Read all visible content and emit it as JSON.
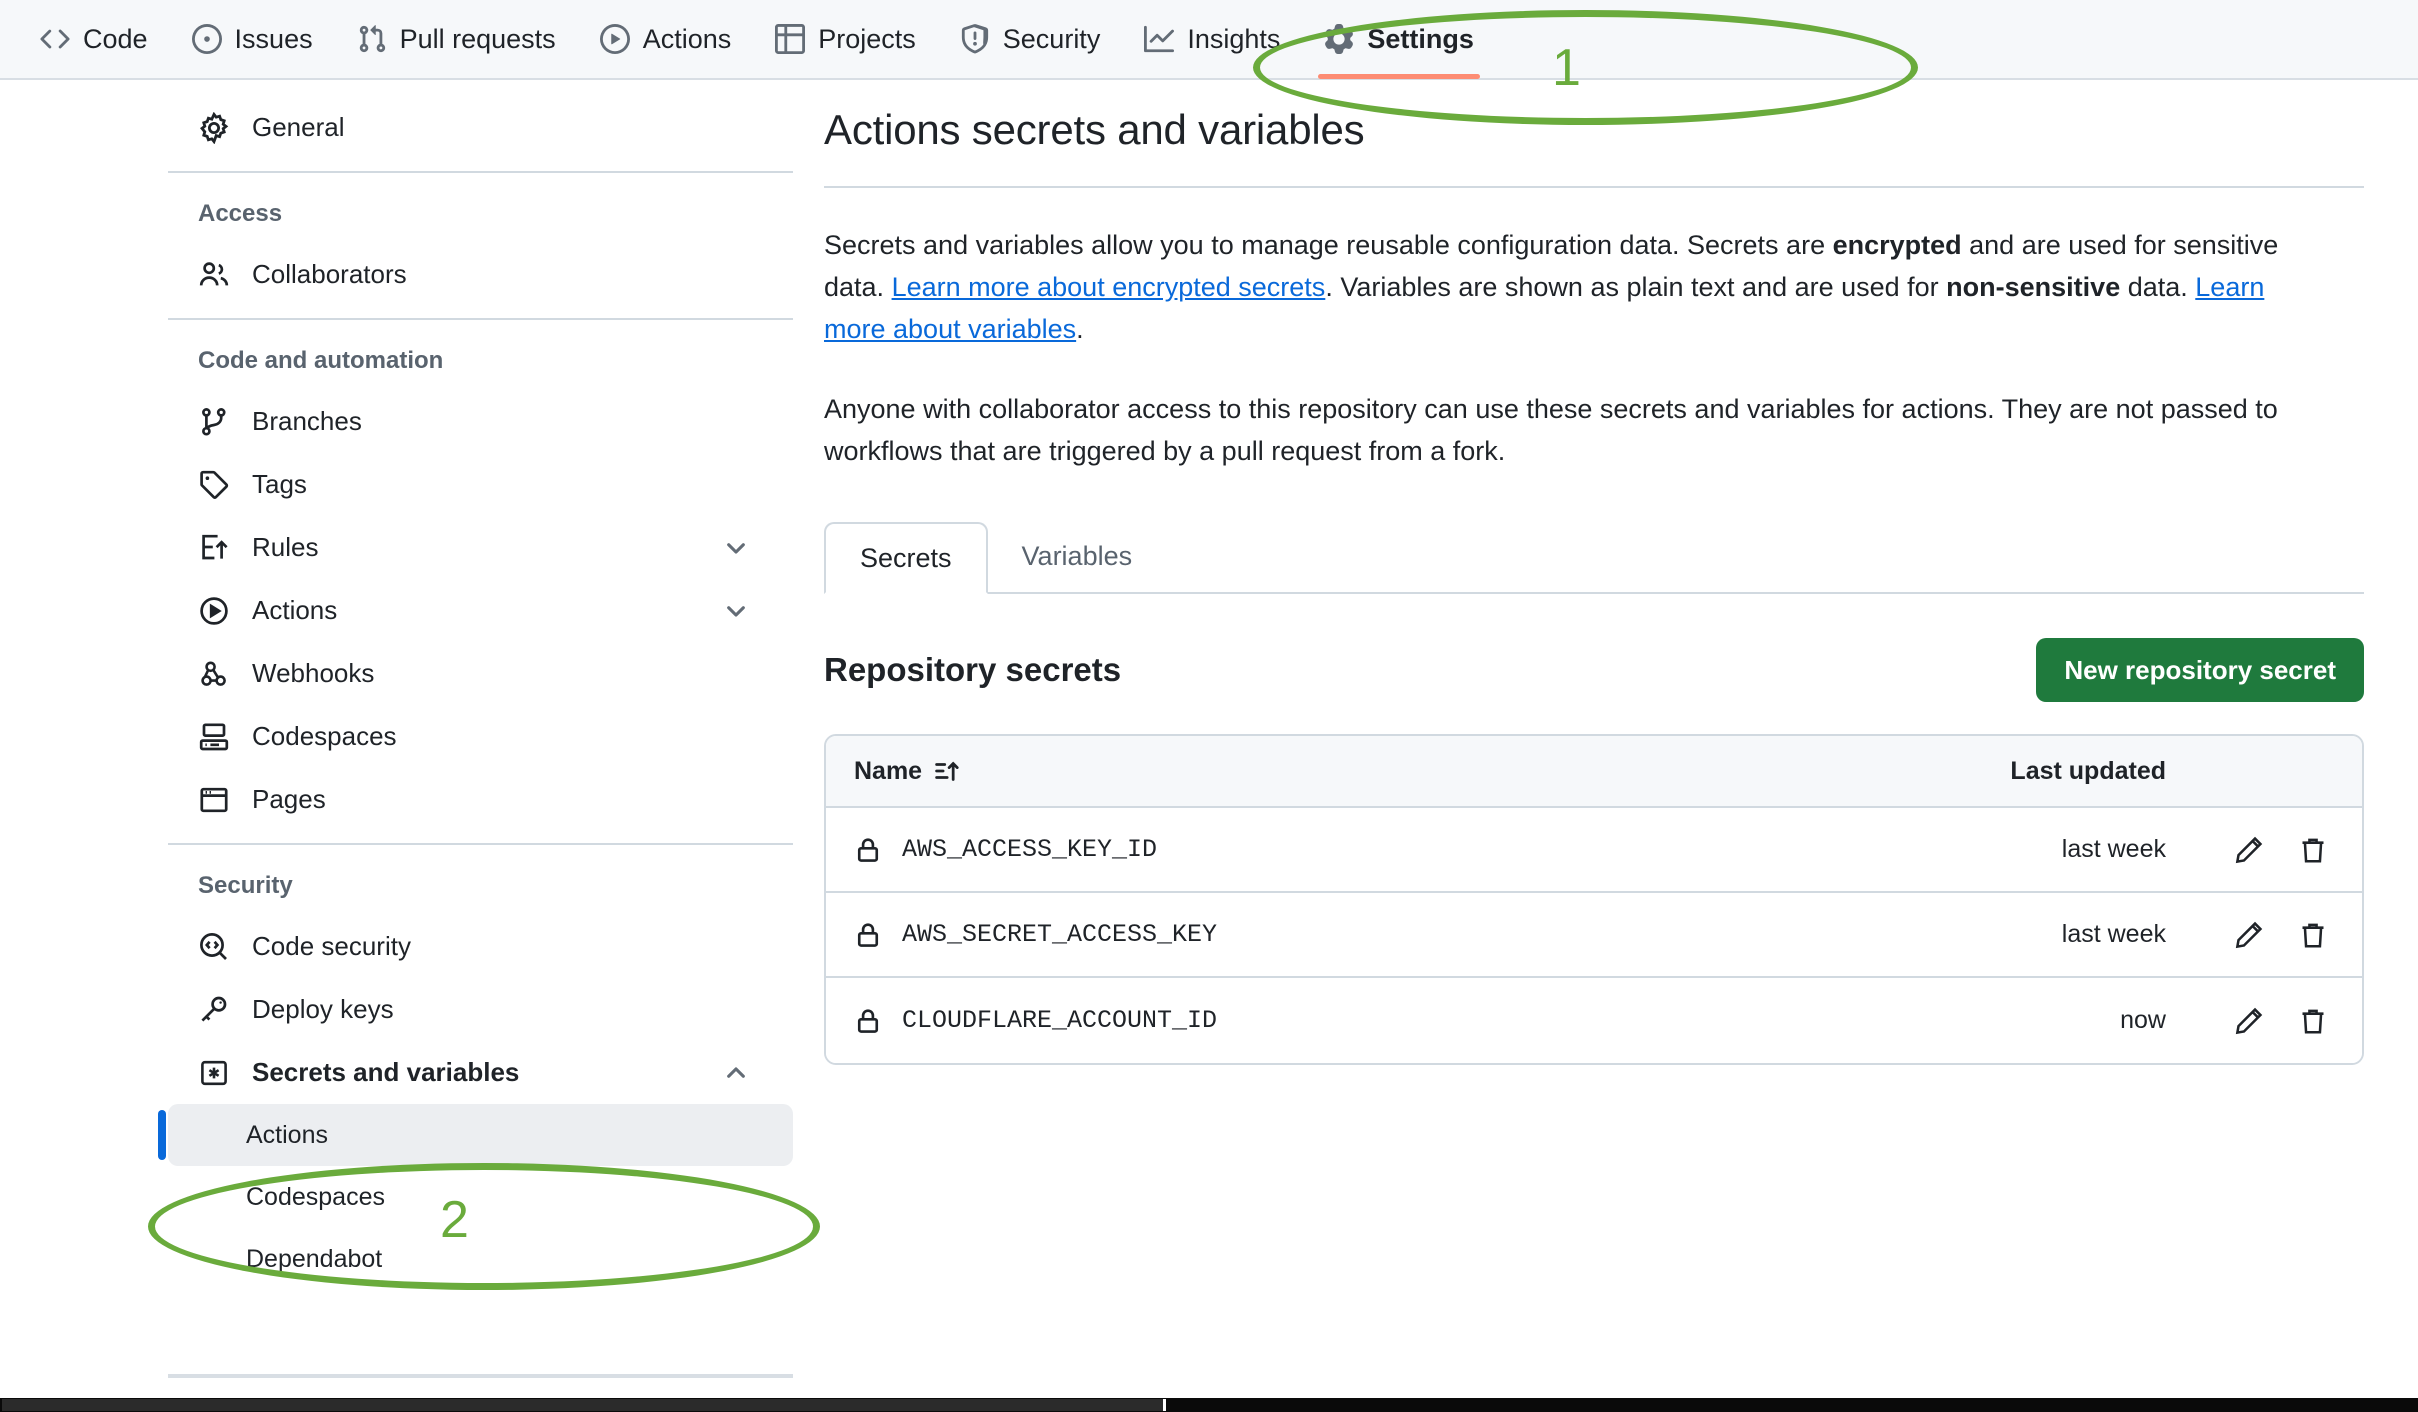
{
  "topnav": {
    "items": [
      {
        "label": "Code",
        "icon": "code-icon",
        "active": false
      },
      {
        "label": "Issues",
        "icon": "issue-opened-icon",
        "active": false
      },
      {
        "label": "Pull requests",
        "icon": "git-pull-request-icon",
        "active": false
      },
      {
        "label": "Actions",
        "icon": "play-icon",
        "active": false
      },
      {
        "label": "Projects",
        "icon": "table-icon",
        "active": false
      },
      {
        "label": "Security",
        "icon": "shield-icon",
        "active": false
      },
      {
        "label": "Insights",
        "icon": "graph-icon",
        "active": false
      },
      {
        "label": "Settings",
        "icon": "gear-icon",
        "active": true
      }
    ]
  },
  "sidebar": {
    "general": {
      "label": "General",
      "icon": "gear-icon"
    },
    "access_heading": "Access",
    "collaborators": {
      "label": "Collaborators",
      "icon": "people-icon"
    },
    "code_heading": "Code and automation",
    "code_items": [
      {
        "label": "Branches",
        "icon": "git-branch-icon",
        "caret": false
      },
      {
        "label": "Tags",
        "icon": "tag-icon",
        "caret": false
      },
      {
        "label": "Rules",
        "icon": "rules-icon",
        "caret": true
      },
      {
        "label": "Actions",
        "icon": "play-icon",
        "caret": true
      },
      {
        "label": "Webhooks",
        "icon": "webhook-icon",
        "caret": false
      },
      {
        "label": "Codespaces",
        "icon": "codespaces-icon",
        "caret": false
      },
      {
        "label": "Pages",
        "icon": "browser-icon",
        "caret": false
      }
    ],
    "security_heading": "Security",
    "security_items": [
      {
        "label": "Code security",
        "icon": "code-scan-icon"
      },
      {
        "label": "Deploy keys",
        "icon": "key-icon"
      }
    ],
    "secrets_group": {
      "label": "Secrets and variables",
      "icon": "asterisk-key-icon",
      "caret": "chevron-up-icon"
    },
    "secrets_sub": [
      {
        "label": "Actions",
        "selected": true
      },
      {
        "label": "Codespaces",
        "selected": false
      },
      {
        "label": "Dependabot",
        "selected": false
      }
    ]
  },
  "main": {
    "title": "Actions secrets and variables",
    "p1_a": "Secrets and variables allow you to manage reusable configuration data. Secrets are ",
    "p1_b": "encrypted",
    "p1_c": " and are used for sensitive data. ",
    "p1_link1": "Learn more about encrypted secrets",
    "p1_d": ". Variables are shown as plain text and are used for ",
    "p1_e": "non-sensitive",
    "p1_f": " data. ",
    "p1_link2": "Learn more about variables",
    "p1_g": ".",
    "p2": "Anyone with collaborator access to this repository can use these secrets and variables for actions. They are not passed to workflows that are triggered by a pull request from a fork.",
    "tabs": [
      {
        "label": "Secrets",
        "active": true
      },
      {
        "label": "Variables",
        "active": false
      }
    ],
    "section_title": "Repository secrets",
    "new_secret_button": "New repository secret",
    "table": {
      "columns": [
        "Name",
        "Last updated"
      ],
      "sort_icon": "sort-asc-icon",
      "rows": [
        {
          "icon": "lock-icon",
          "name": "AWS_ACCESS_KEY_ID",
          "last_updated": "last week",
          "edit_icon": "pencil-icon",
          "delete_icon": "trash-icon"
        },
        {
          "icon": "lock-icon",
          "name": "AWS_SECRET_ACCESS_KEY",
          "last_updated": "last week",
          "edit_icon": "pencil-icon",
          "delete_icon": "trash-icon"
        },
        {
          "icon": "lock-icon",
          "name": "CLOUDFLARE_ACCOUNT_ID",
          "last_updated": "now",
          "edit_icon": "pencil-icon",
          "delete_icon": "trash-icon"
        }
      ]
    }
  },
  "annotations": {
    "color": "#6aab3c",
    "steps": [
      {
        "number": "1",
        "target": "Settings"
      },
      {
        "number": "2",
        "target": "Actions"
      }
    ]
  }
}
